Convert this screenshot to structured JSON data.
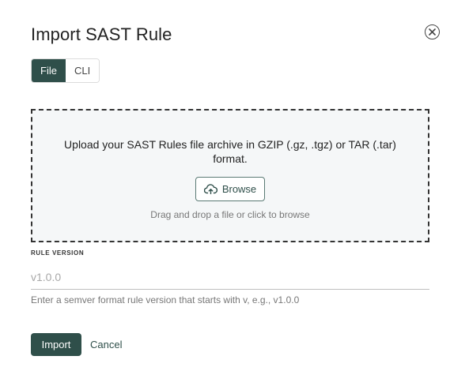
{
  "dialog": {
    "title": "Import SAST Rule",
    "close_icon": "close-circle-icon"
  },
  "tabs": [
    {
      "label": "File",
      "active": true
    },
    {
      "label": "CLI",
      "active": false
    }
  ],
  "dropzone": {
    "instruction": "Upload your SAST Rules file archive in GZIP (.gz, .tgz) or TAR (.tar) format.",
    "browse_label": "Browse",
    "browse_icon": "cloud-upload-icon",
    "hint": "Drag and drop a file or click to browse"
  },
  "rule_version": {
    "label": "RULE VERSION",
    "value": "",
    "placeholder": "v1.0.0",
    "helper": "Enter a semver format rule version that starts with v, e.g., v1.0.0"
  },
  "actions": {
    "import_label": "Import",
    "cancel_label": "Cancel"
  },
  "colors": {
    "primary": "#2f4f4a",
    "dropzone_bg": "#f5f7f8"
  }
}
